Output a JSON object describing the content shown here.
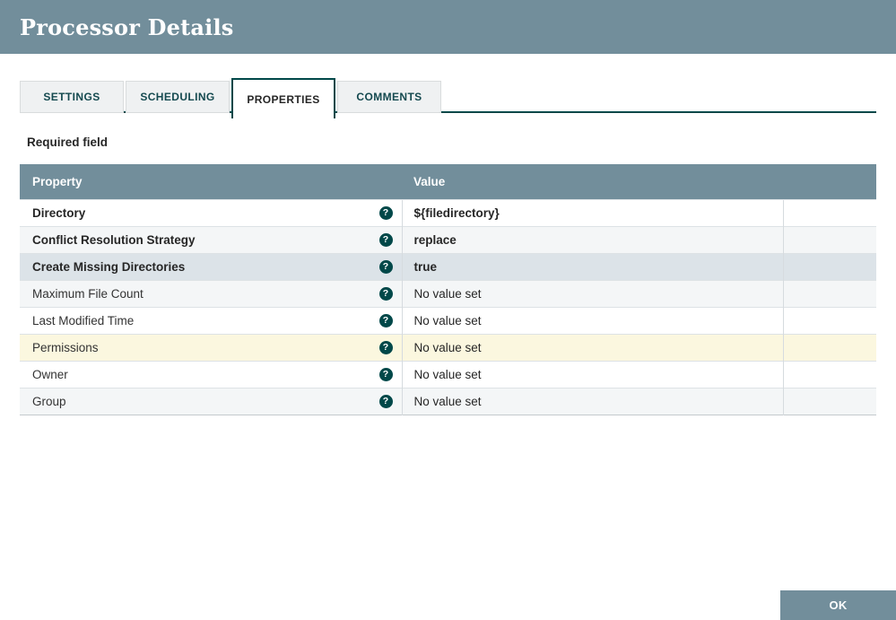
{
  "dialog": {
    "title": "Processor Details"
  },
  "tabs": [
    {
      "label": "SETTINGS",
      "active": false
    },
    {
      "label": "SCHEDULING",
      "active": false
    },
    {
      "label": "PROPERTIES",
      "active": true
    },
    {
      "label": "COMMENTS",
      "active": false
    }
  ],
  "content": {
    "required_field_label": "Required field"
  },
  "table": {
    "columns": [
      {
        "label": "Property"
      },
      {
        "label": "Value"
      }
    ],
    "help_icon_glyph": "?",
    "rows": [
      {
        "property": "Directory",
        "value": "${filedirectory}",
        "set": true,
        "state": "default"
      },
      {
        "property": "Conflict Resolution Strategy",
        "value": "replace",
        "set": true,
        "state": "alt"
      },
      {
        "property": "Create Missing Directories",
        "value": "true",
        "set": true,
        "state": "selected"
      },
      {
        "property": "Maximum File Count",
        "value": "No value set",
        "set": false,
        "state": "alt"
      },
      {
        "property": "Last Modified Time",
        "value": "No value set",
        "set": false,
        "state": "default"
      },
      {
        "property": "Permissions",
        "value": "No value set",
        "set": false,
        "state": "highlight"
      },
      {
        "property": "Owner",
        "value": "No value set",
        "set": false,
        "state": "default"
      },
      {
        "property": "Group",
        "value": "No value set",
        "set": false,
        "state": "alt"
      }
    ]
  },
  "footer": {
    "ok_label": "OK"
  },
  "colors": {
    "header_bg": "#728e9b",
    "accent_teal": "#004849",
    "selected_row_bg": "#dce3e8",
    "highlight_row_bg": "#fbf7df",
    "alt_row_bg": "#f4f6f7",
    "unset_value_text": "#9da1a4"
  }
}
